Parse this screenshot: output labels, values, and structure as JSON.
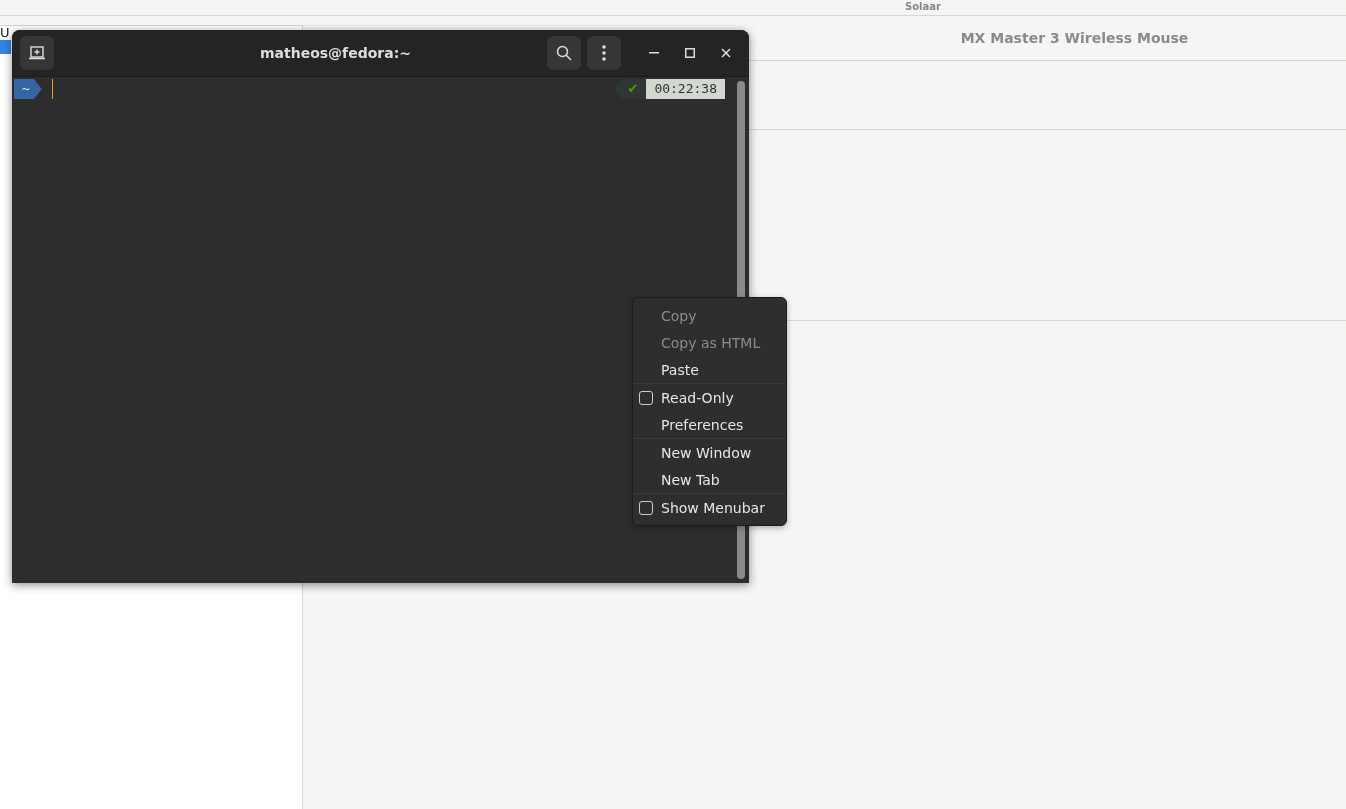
{
  "background_app": {
    "header_text": "Solaar",
    "sidebar": {
      "items": [
        {
          "label": "U",
          "selected": false
        },
        {
          "selected": true
        }
      ]
    },
    "device_title": "MX Master 3 Wireless Mouse"
  },
  "terminal": {
    "title": "matheos@fedora:~",
    "prompt": {
      "directory": "~",
      "status": "✔",
      "time": "00:22:38"
    }
  },
  "context_menu": {
    "sections": [
      {
        "items": [
          {
            "label": "Copy",
            "kind": "action",
            "disabled": true
          },
          {
            "label": "Copy as HTML",
            "kind": "action",
            "disabled": true
          },
          {
            "label": "Paste",
            "kind": "action",
            "disabled": false
          }
        ]
      },
      {
        "items": [
          {
            "label": "Read-Only",
            "kind": "check",
            "checked": false,
            "disabled": false
          },
          {
            "label": "Preferences",
            "kind": "action",
            "disabled": false
          }
        ]
      },
      {
        "items": [
          {
            "label": "New Window",
            "kind": "action",
            "disabled": false
          },
          {
            "label": "New Tab",
            "kind": "action",
            "disabled": false
          }
        ]
      },
      {
        "items": [
          {
            "label": "Show Menubar",
            "kind": "check",
            "checked": false,
            "disabled": false
          }
        ]
      }
    ]
  }
}
